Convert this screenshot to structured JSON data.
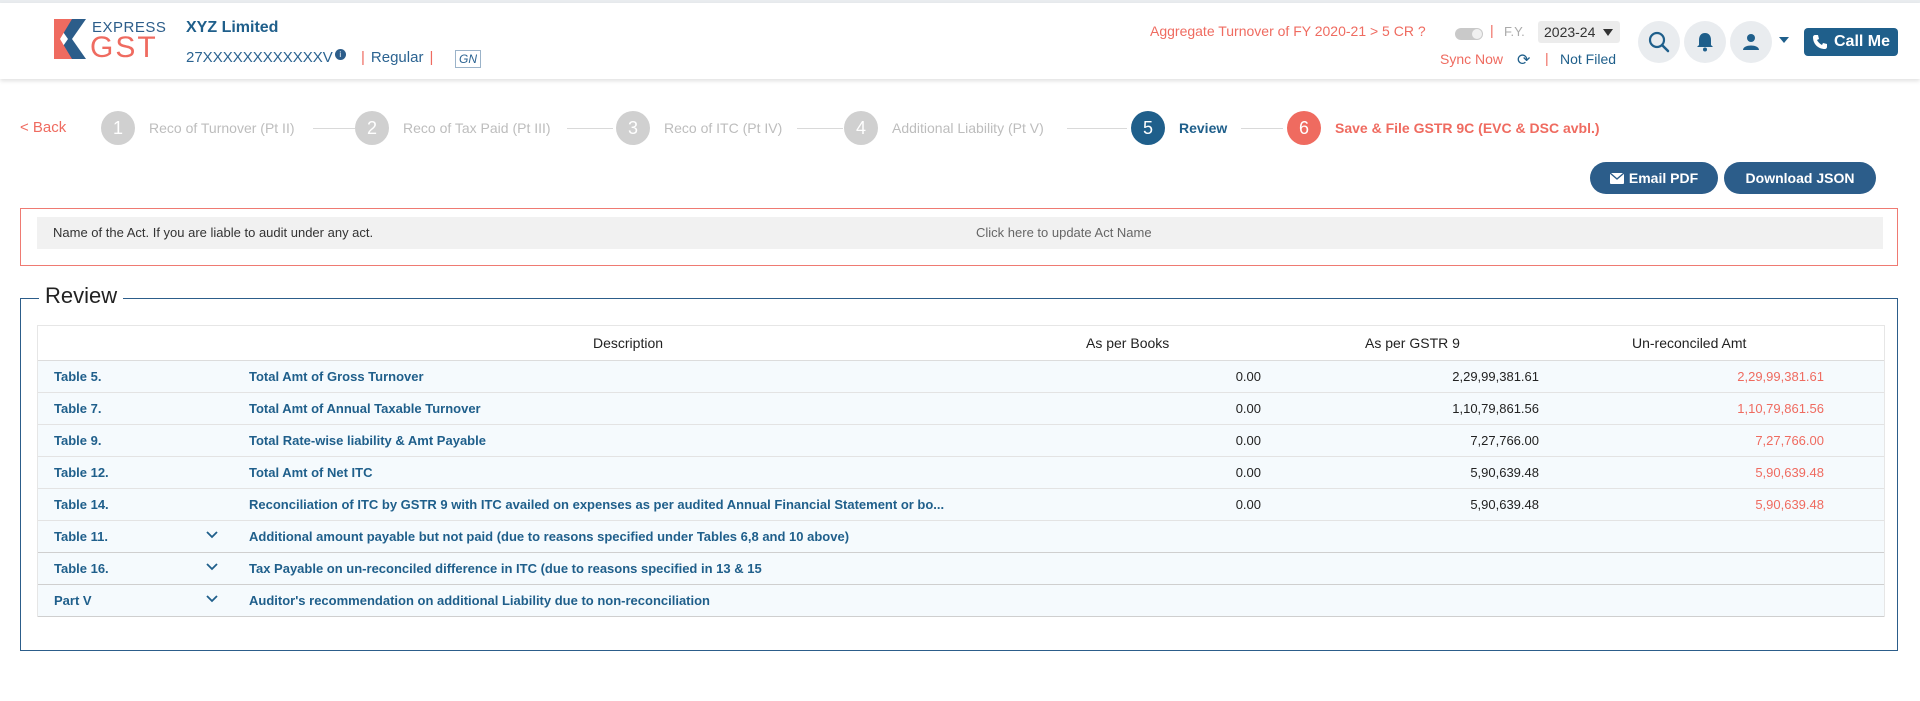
{
  "header": {
    "logo_top": "EXPRESS",
    "logo_bottom": "GST",
    "company_name": "XYZ Limited",
    "gstin": "27XXXXXXXXXXXXV",
    "gstin_info": "i",
    "taxpayer_type": "Regular",
    "gstn_badge": "GN",
    "turnover_question": "Aggregate Turnover of FY 2020-21 > 5 CR ?",
    "fy_label": "F.Y.",
    "fy_value": "2023-24",
    "sync_label": "Sync Now",
    "status": "Not Filed",
    "call_label": "Call Me"
  },
  "stepper": {
    "back_label": "< Back",
    "steps": [
      {
        "num": "1",
        "label": "Reco of Turnover (Pt II)"
      },
      {
        "num": "2",
        "label": "Reco of Tax Paid (Pt III)"
      },
      {
        "num": "3",
        "label": "Reco of ITC (Pt IV)"
      },
      {
        "num": "4",
        "label": "Additional Liability (Pt V)"
      },
      {
        "num": "5",
        "label": "Review"
      },
      {
        "num": "6",
        "label": "Save & File GSTR 9C (EVC & DSC avbl.)"
      }
    ]
  },
  "actions": {
    "email_pdf": "Email PDF",
    "download_json": "Download JSON"
  },
  "act": {
    "label": "Name of the Act. If you are liable to audit under any act.",
    "link": "Click here to update Act Name"
  },
  "review": {
    "title": "Review",
    "columns": {
      "description": "Description",
      "books": "As per Books",
      "gstr9": "As per GSTR 9",
      "unreconciled": "Un-reconciled Amt"
    },
    "rows": [
      {
        "table": "Table 5.",
        "desc": "Total Amt of Gross Turnover",
        "books": "0.00",
        "gstr9": "2,29,99,381.61",
        "unrec": "2,29,99,381.61"
      },
      {
        "table": "Table 7.",
        "desc": "Total Amt of Annual Taxable Turnover",
        "books": "0.00",
        "gstr9": "1,10,79,861.56",
        "unrec": "1,10,79,861.56"
      },
      {
        "table": "Table 9.",
        "desc": "Total Rate-wise liability & Amt Payable",
        "books": "0.00",
        "gstr9": "7,27,766.00",
        "unrec": "7,27,766.00"
      },
      {
        "table": "Table 12.",
        "desc": "Total Amt of Net ITC",
        "books": "0.00",
        "gstr9": "5,90,639.48",
        "unrec": "5,90,639.48"
      },
      {
        "table": "Table 14.",
        "desc": "Reconciliation of ITC by GSTR 9 with ITC availed on expenses as per audited Annual Financial Statement or bo...",
        "books": "0.00",
        "gstr9": "5,90,639.48",
        "unrec": "5,90,639.48"
      }
    ],
    "expandable_rows": [
      {
        "table": "Table 11.",
        "desc": "Additional amount payable but not paid (due to reasons specified under Tables 6,8 and 10 above)"
      },
      {
        "table": "Table 16.",
        "desc": "Tax Payable on un-reconciled difference in ITC (due to reasons specified in 13 & 15"
      },
      {
        "table": "Part V",
        "desc": "Auditor's recommendation on additional Liability due to non-reconciliation"
      }
    ]
  },
  "colors": {
    "primary": "#1f5f8b",
    "accent": "#ef6b60",
    "inactive_step": "#d0d0d0"
  }
}
